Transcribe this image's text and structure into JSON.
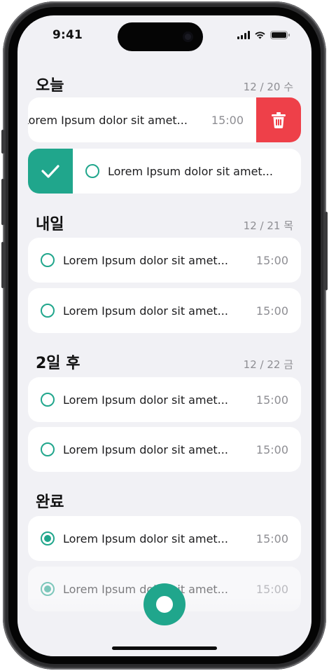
{
  "status_bar": {
    "time": "9:41",
    "icons": [
      "signal-icon",
      "wifi-icon",
      "battery-icon"
    ]
  },
  "accent_color": "#20a68c",
  "delete_color": "#ee4049",
  "sections": [
    {
      "title": "오늘",
      "date": "12 / 20 수",
      "tasks": [
        {
          "text": "Lorem Ipsum dolor sit amet...",
          "time": "15:00",
          "state": "swiped-delete"
        },
        {
          "text": "Lorem Ipsum dolor sit amet...",
          "time": "15:00",
          "state": "swiped-complete"
        }
      ]
    },
    {
      "title": "내일",
      "date": "12 / 21 목",
      "tasks": [
        {
          "text": "Lorem Ipsum dolor sit amet...",
          "time": "15:00",
          "state": "open"
        },
        {
          "text": "Lorem Ipsum dolor sit amet...",
          "time": "15:00",
          "state": "open"
        }
      ]
    },
    {
      "title": "2일 후",
      "date": "12 / 22 금",
      "tasks": [
        {
          "text": "Lorem Ipsum dolor sit amet...",
          "time": "15:00",
          "state": "open"
        },
        {
          "text": "Lorem Ipsum dolor sit amet...",
          "time": "15:00",
          "state": "open"
        }
      ]
    },
    {
      "title": "완료",
      "date": "",
      "tasks": [
        {
          "text": "Lorem Ipsum dolor sit amet...",
          "time": "15:00",
          "state": "done"
        },
        {
          "text": "Lorem Ipsum dolor sit amet...",
          "time": "15:00",
          "state": "done"
        }
      ]
    }
  ],
  "fab_icon": "add-task-icon"
}
